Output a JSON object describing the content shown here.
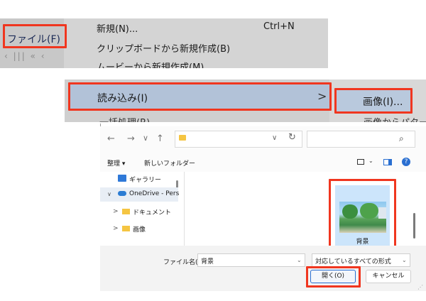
{
  "file_menu": {
    "button_label": "ファイル(F)",
    "nav_glyphs": "‹  |||  «   ‹",
    "items": [
      {
        "label": "新規(N)...",
        "shortcut": "Ctrl+N"
      },
      {
        "label": "クリップボードから新規作成(B)"
      },
      {
        "label": "ムービーから新規作成(M)"
      }
    ]
  },
  "import_menu": {
    "import_label": "読み込み(I)",
    "arrow": ">",
    "batch_label": "一括処理(R)...",
    "submenu": {
      "image_label": "画像(I)...",
      "from_pattern_label": "画像からパター"
    }
  },
  "dialog": {
    "toolbar": {
      "organize_label": "整理 ▾",
      "new_folder_label": "新しいフォルダー"
    },
    "nav_pane": {
      "gallery": "ギャラリー",
      "onedrive": "OneDrive - Pers",
      "documents": "ドキュメント",
      "pictures": "画像"
    },
    "file": {
      "name": "背景"
    },
    "filename_label": "ファイル名(N):",
    "filename_value": "背景",
    "filetype_value": "対応しているすべての形式",
    "open_label": "開く(O)",
    "cancel_label": "キャンセル"
  },
  "icons": {
    "back": "←",
    "forward": "→",
    "down": "∨",
    "up": "↑",
    "refresh": "↻",
    "search": "⌕",
    "chevron_right": ">",
    "chevron_down": "∨",
    "help": "?",
    "dropdown": "⌄"
  },
  "colors": {
    "highlight": "#f0361f",
    "selection": "#cce5fb",
    "accent": "#2a6fd1"
  }
}
